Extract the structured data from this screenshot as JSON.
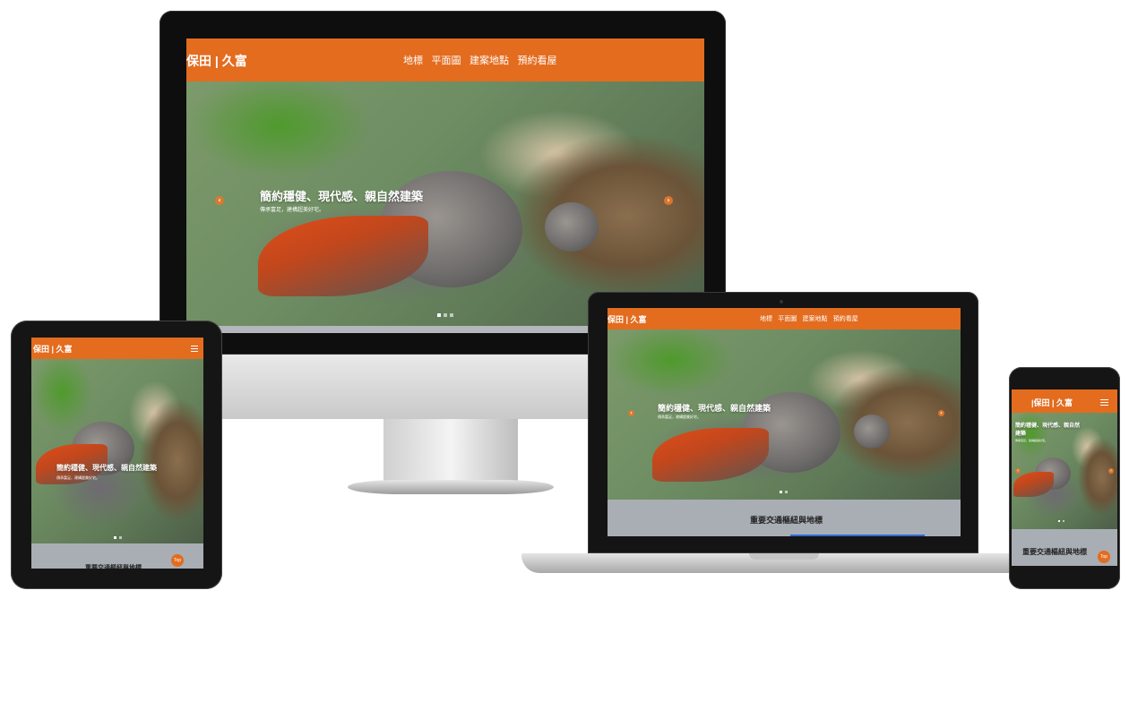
{
  "site": {
    "logo": "保田 | 久富",
    "logo_compact": "|保田 | 久富",
    "nav": [
      "地標",
      "平面圖",
      "建案地點",
      "預約看屋"
    ],
    "hero_title": "簡約穩健、現代感、親自然建築",
    "hero_title_wrap1": "簡約穩健、現代感、親自然",
    "hero_title_wrap2": "建築",
    "hero_subtitle": "傳承富足，建構超美好宅。",
    "section_title": "重要交通樞紐與地標",
    "top_button": "Top"
  },
  "colors": {
    "accent": "#e36c1f",
    "section_bg": "#a9aeb4",
    "device_frame": "#141414"
  },
  "icons": [
    "chevron-left-icon",
    "chevron-right-icon",
    "hamburger-icon"
  ]
}
